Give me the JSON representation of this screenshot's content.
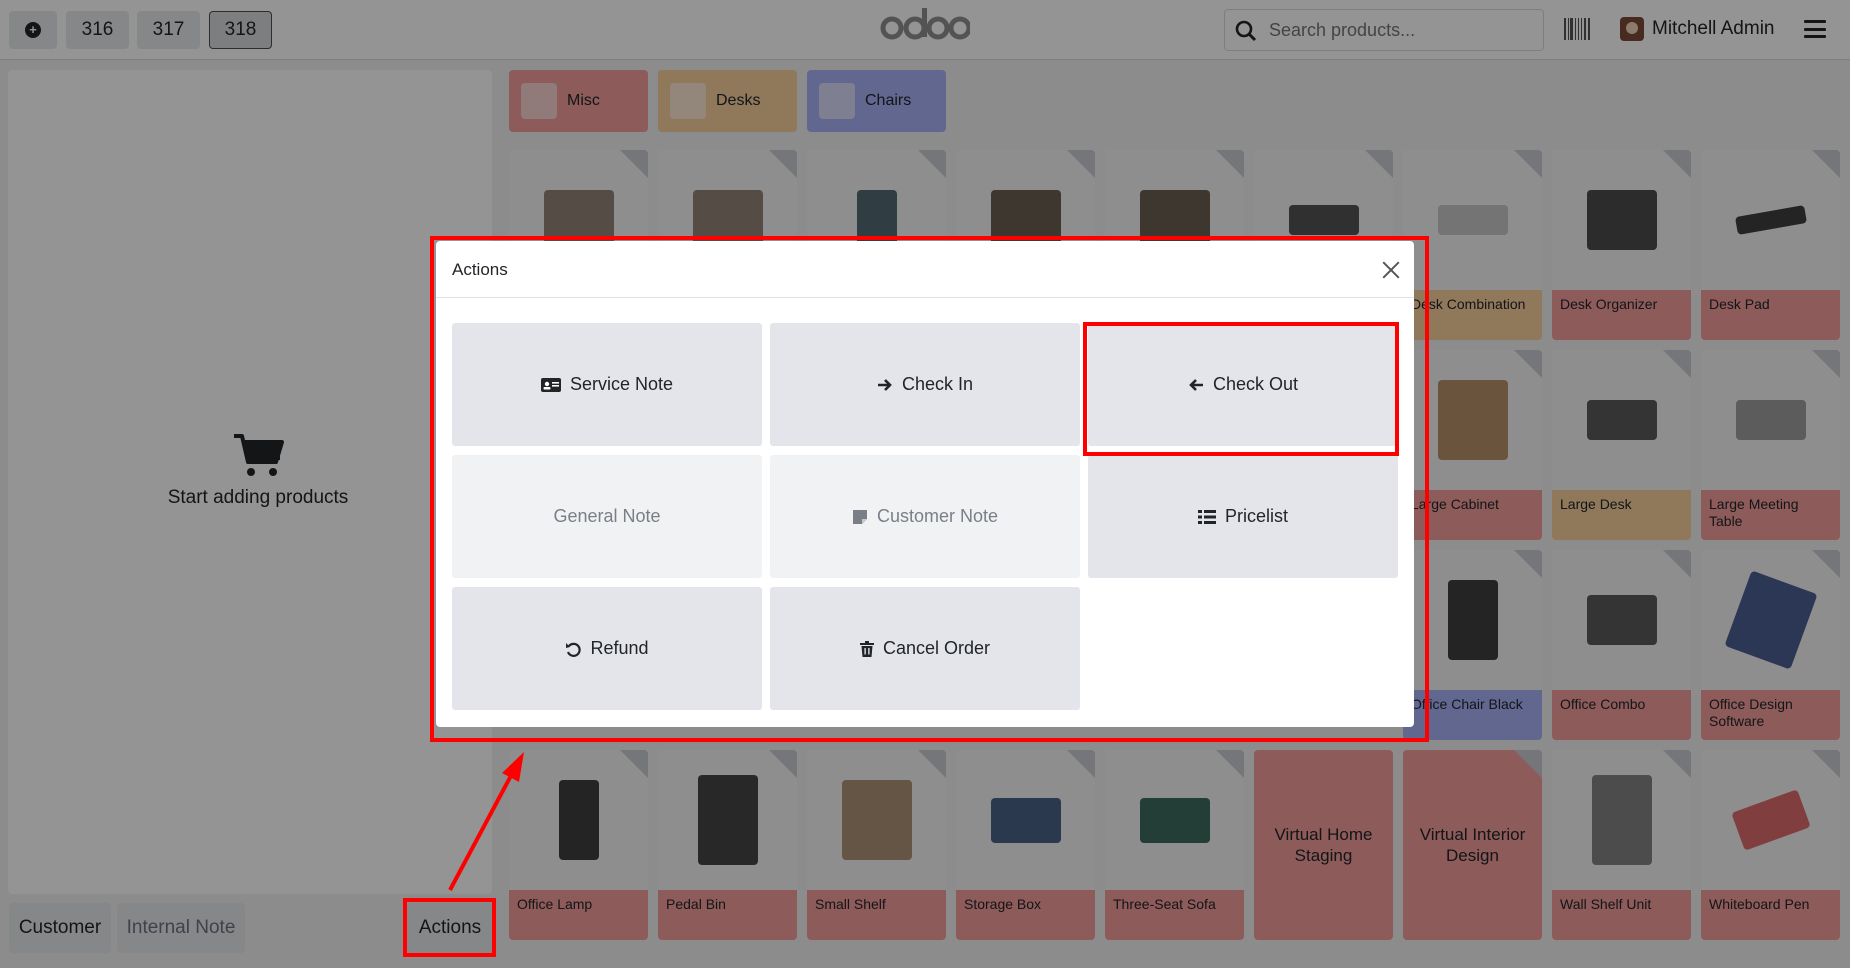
{
  "topbar": {
    "orders": [
      "316",
      "317",
      "318"
    ],
    "logo": "odoo",
    "search_placeholder": "Search products...",
    "user_name": "Mitchell Admin"
  },
  "left_pane": {
    "empty_message": "Start adding products",
    "customer_label": "Customer",
    "internal_note_label": "Internal Note",
    "actions_label": "Actions"
  },
  "categories": [
    {
      "label": "Misc",
      "color": "#f49d9d"
    },
    {
      "label": "Desks",
      "color": "#f8cf9d"
    },
    {
      "label": "Chairs",
      "color": "#aab1f9"
    }
  ],
  "products": [
    {
      "name": "Desk Combination"
    },
    {
      "name": "Desk Organizer"
    },
    {
      "name": "Desk Pad"
    },
    {
      "name": "Large Cabinet"
    },
    {
      "name": "Large Desk"
    },
    {
      "name": "Large Meeting Table"
    },
    {
      "name": "Office Chair Black"
    },
    {
      "name": "Office Combo"
    },
    {
      "name": "Office Design Software"
    },
    {
      "name": "Office Lamp"
    },
    {
      "name": "Pedal Bin"
    },
    {
      "name": "Small Shelf"
    },
    {
      "name": "Storage Box"
    },
    {
      "name": "Three-Seat Sofa"
    },
    {
      "name": "Virtual Home Staging"
    },
    {
      "name": "Virtual Interior Design"
    },
    {
      "name": "Wall Shelf Unit"
    },
    {
      "name": "Whiteboard Pen"
    }
  ],
  "dialog": {
    "title": "Actions",
    "actions": [
      {
        "label": "Service Note",
        "icon": "id-card-icon",
        "enabled": true
      },
      {
        "label": "Check In",
        "icon": "arrow-right-icon",
        "enabled": true
      },
      {
        "label": "Check Out",
        "icon": "arrow-left-icon",
        "enabled": true
      },
      {
        "label": "General Note",
        "icon": "",
        "enabled": false
      },
      {
        "label": "Customer Note",
        "icon": "sticky-note-icon",
        "enabled": false
      },
      {
        "label": "Pricelist",
        "icon": "list-icon",
        "enabled": true
      },
      {
        "label": "Refund",
        "icon": "undo-icon",
        "enabled": true
      },
      {
        "label": "Cancel Order",
        "icon": "trash-icon",
        "enabled": true
      }
    ]
  },
  "annotations": {
    "color": "#ff0000"
  }
}
